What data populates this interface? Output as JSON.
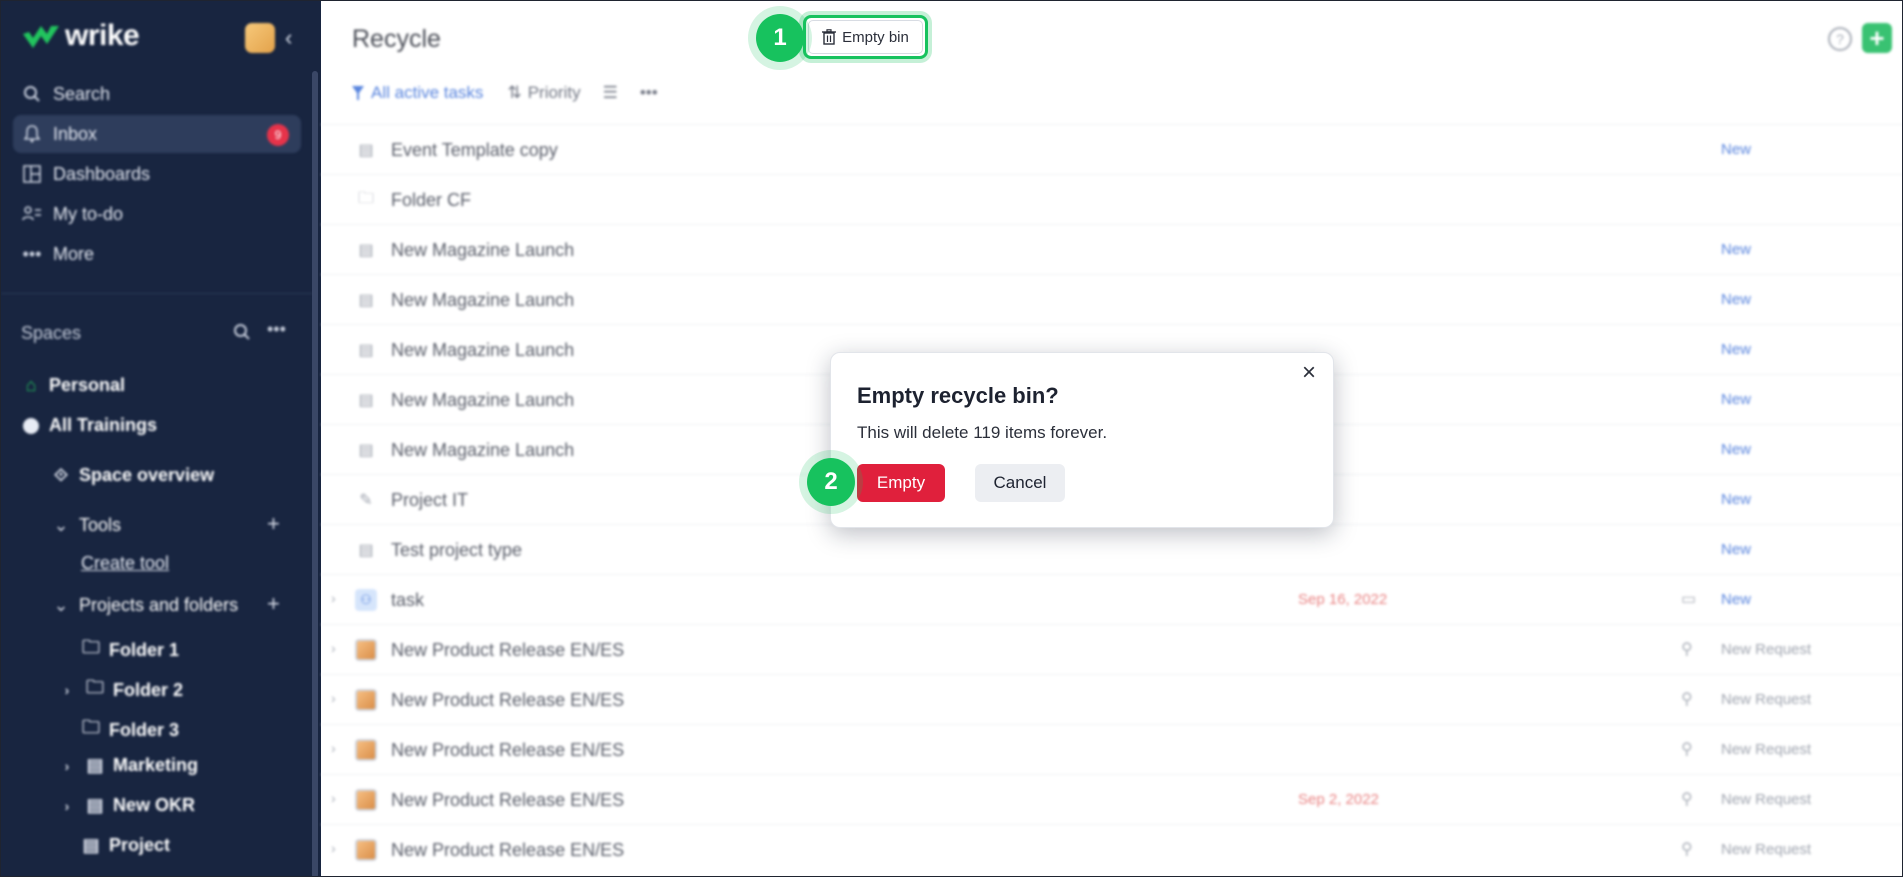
{
  "app": {
    "logo": "wrike"
  },
  "sidebar": {
    "nav": [
      {
        "label": "Search",
        "icon": "search-icon"
      },
      {
        "label": "Inbox",
        "icon": "bell-icon",
        "badge": "9"
      },
      {
        "label": "Dashboards",
        "icon": "dashboard-icon"
      },
      {
        "label": "My to-do",
        "icon": "todo-icon"
      },
      {
        "label": "More",
        "icon": "more-icon"
      }
    ],
    "spaces_label": "Spaces",
    "personal": "Personal",
    "all_trainings": "All Trainings",
    "space_overview": "Space overview",
    "tools": "Tools",
    "create_tool": "Create tool",
    "projects_and_folders": "Projects and folders",
    "folder1": "Folder 1",
    "folder2": "Folder 2",
    "folder3": "Folder 3",
    "marketing": "Marketing",
    "new_okr": "New OKR",
    "project": "Project"
  },
  "main": {
    "title": "Recycle",
    "empty_bin_label": "Empty bin",
    "filter_label": "All active tasks",
    "sort_label": "Priority",
    "help_glyph": "?",
    "add_glyph": "+"
  },
  "rows": [
    {
      "name": "Event Template copy",
      "status": "New"
    },
    {
      "name": "Folder CF",
      "status": ""
    },
    {
      "name": "New Magazine Launch",
      "status": "New"
    },
    {
      "name": "New Magazine Launch",
      "status": "New"
    },
    {
      "name": "New Magazine Launch",
      "status": "New"
    },
    {
      "name": "New Magazine Launch",
      "status": "New"
    },
    {
      "name": "New Magazine Launch",
      "status": "New"
    },
    {
      "name": "Project IT",
      "status": "New"
    },
    {
      "name": "Test project type",
      "status": "New"
    },
    {
      "name": "task",
      "date": "Sep 16, 2022",
      "status": "New"
    },
    {
      "name": "New Product Release EN/ES",
      "status": "New Request"
    },
    {
      "name": "New Product Release EN/ES",
      "status": "New Request"
    },
    {
      "name": "New Product Release EN/ES",
      "status": "New Request"
    },
    {
      "name": "New Product Release EN/ES",
      "date": "Sep 2, 2022",
      "status": "New Request"
    },
    {
      "name": "New Product Release EN/ES",
      "status": "New Request"
    }
  ],
  "dialog": {
    "title": "Empty recycle bin?",
    "message": "This will delete 119 items forever.",
    "confirm_label": "Empty",
    "cancel_label": "Cancel"
  },
  "steps": {
    "one": "1",
    "two": "2"
  },
  "colors": {
    "sidebar_bg": "#182540",
    "highlight_green": "#17c25e",
    "danger_red": "#e0203c",
    "link_blue": "#3b6fd8"
  }
}
